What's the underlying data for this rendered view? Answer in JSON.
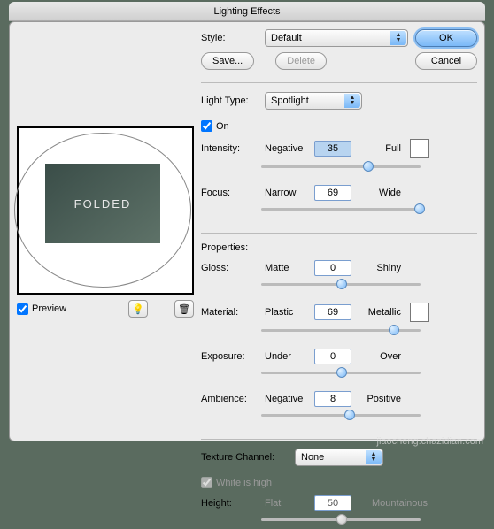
{
  "window": {
    "title": "Lighting Effects"
  },
  "buttons": {
    "ok": "OK",
    "cancel": "Cancel",
    "save": "Save...",
    "delete": "Delete"
  },
  "style": {
    "label": "Style:",
    "value": "Default"
  },
  "lightType": {
    "label": "Light Type:",
    "value": "Spotlight"
  },
  "on": {
    "label": "On",
    "checked": true
  },
  "intensity": {
    "label": "Intensity:",
    "left": "Negative",
    "right": "Full",
    "value": "35",
    "pos": 64
  },
  "focus": {
    "label": "Focus:",
    "left": "Narrow",
    "right": "Wide",
    "value": "69",
    "pos": 96
  },
  "properties": {
    "label": "Properties:"
  },
  "gloss": {
    "label": "Gloss:",
    "left": "Matte",
    "right": "Shiny",
    "value": "0",
    "pos": 47
  },
  "material": {
    "label": "Material:",
    "left": "Plastic",
    "right": "Metallic",
    "value": "69",
    "pos": 80
  },
  "exposure": {
    "label": "Exposure:",
    "left": "Under",
    "right": "Over",
    "value": "0",
    "pos": 47
  },
  "ambience": {
    "label": "Ambience:",
    "left": "Negative",
    "right": "Positive",
    "value": "8",
    "pos": 52
  },
  "texture": {
    "label": "Texture Channel:",
    "value": "None"
  },
  "whiteHigh": {
    "label": "White is high",
    "checked": true
  },
  "height": {
    "label": "Height:",
    "left": "Flat",
    "right": "Mountainous",
    "value": "50",
    "pos": 47
  },
  "preview": {
    "label": "Preview",
    "checked": true,
    "text": "FOLDED"
  },
  "watermark": "jiaocheng.chazidian.com"
}
